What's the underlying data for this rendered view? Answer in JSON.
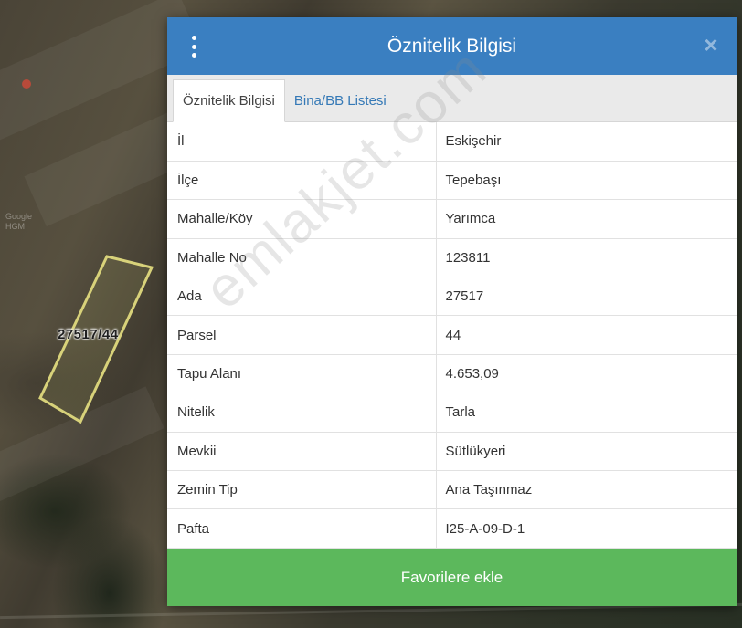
{
  "map": {
    "parcel_label": "27517/44",
    "tiny_label": "Google\nHGM"
  },
  "panel": {
    "title": "Öznitelik Bilgisi",
    "menu_icon": "vertical-dots-icon",
    "close_icon": "close-icon",
    "tabs": [
      {
        "label": "Öznitelik Bilgisi",
        "active": true
      },
      {
        "label": "Bina/BB Listesi",
        "active": false
      }
    ],
    "rows": [
      {
        "key": "İl",
        "value": "Eskişehir"
      },
      {
        "key": "İlçe",
        "value": "Tepebaşı"
      },
      {
        "key": "Mahalle/Köy",
        "value": "Yarımca"
      },
      {
        "key": "Mahalle No",
        "value": "123811"
      },
      {
        "key": "Ada",
        "value": "27517"
      },
      {
        "key": "Parsel",
        "value": "44"
      },
      {
        "key": "Tapu Alanı",
        "value": "4.653,09"
      },
      {
        "key": "Nitelik",
        "value": "Tarla"
      },
      {
        "key": "Mevkii",
        "value": "Sütlükyeri"
      },
      {
        "key": "Zemin Tip",
        "value": "Ana Taşınmaz"
      },
      {
        "key": "Pafta",
        "value": "I25-A-09-D-1"
      }
    ],
    "favorite_button": "Favorilere ekle"
  },
  "watermark": "emlakjet.com",
  "colors": {
    "header": "#3a7fc1",
    "button": "#5cb85c",
    "tab_link": "#3579b6",
    "parcel_outline": "#d8d27a"
  }
}
